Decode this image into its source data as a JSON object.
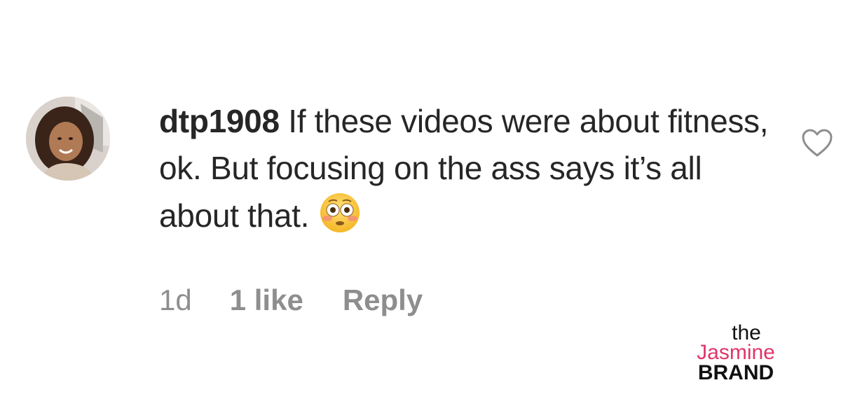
{
  "comment": {
    "username": "dtp1908",
    "text": "If these videos were about fitness, ok. But focusing on the ass says it’s all about that.",
    "emoji": "flushed-face-emoji"
  },
  "meta": {
    "time": "1d",
    "likes": "1 like",
    "reply": "Reply"
  },
  "icons": {
    "like": "heart-outline-icon"
  },
  "watermark": {
    "line1": "the",
    "line2": "Jasmine",
    "line3": "BRAND"
  },
  "colors": {
    "text": "#262626",
    "meta": "#8e8e8e",
    "watermark_accent": "#e0356b"
  }
}
